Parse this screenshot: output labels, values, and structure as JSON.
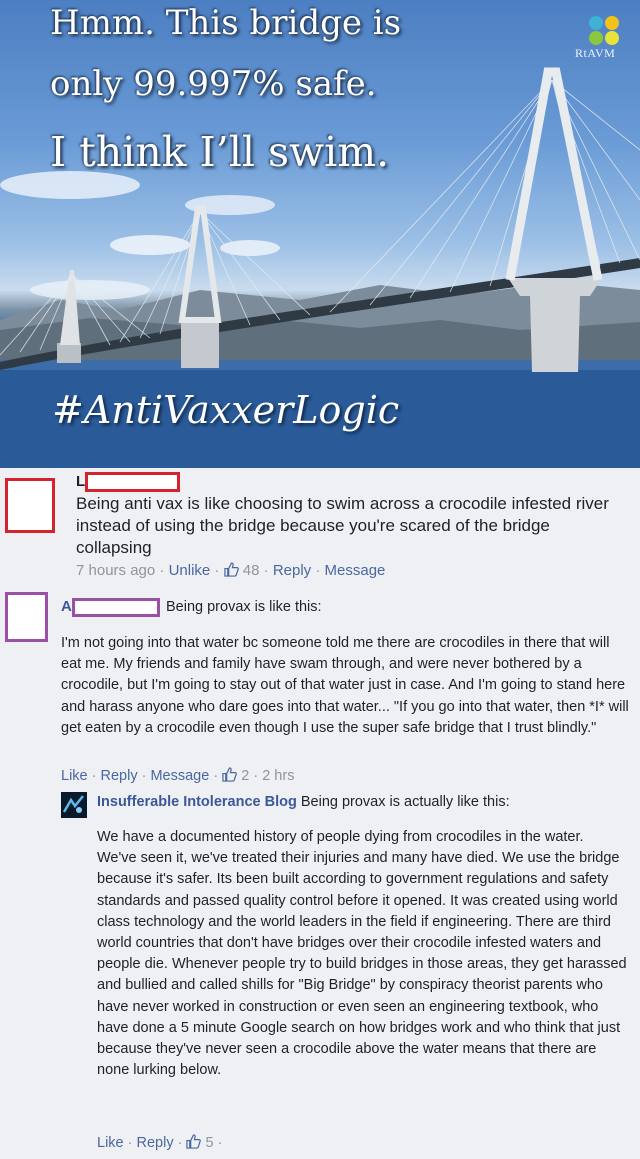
{
  "meme": {
    "line1": "Hmm. This bridge is",
    "line2": "only 99.997% safe.",
    "line3": "I think I’ll swim.",
    "hashtag": "#AntiVaxxerLogic",
    "brand": "RtAVM",
    "brand_icon": "four-dot-logo-icon"
  },
  "comments": [
    {
      "initial": "L",
      "text": "Being anti vax is like choosing to swim across a crocodile infested river instead of using the bridge because you're scared of the bridge collapsing",
      "time": "7 hours ago",
      "unlike": "Unlike",
      "likes": "48",
      "reply": "Reply",
      "message": "Message",
      "redact_color": "#d3232d"
    },
    {
      "initial": "A",
      "lead": "Being provax is like this:",
      "text": "I'm not going into that water bc someone told me there are crocodiles in there that will eat me. My friends and family have swam through, and were never bothered by a crocodile, but I'm going to stay out of that water just in case. And I'm going to stand here and harass anyone who dare goes into that water... \"If you go into that water, then *I* will get eaten by a crocodile even though I use the super safe bridge that I trust blindly.\"",
      "like": "Like",
      "reply": "Reply",
      "message": "Message",
      "likes": "2",
      "time": "2 hrs",
      "redact_color": "#9b4fa5"
    },
    {
      "author": "Insufferable Intolerance Blog",
      "lead": "Being provax is actually like this:",
      "text": "We have a documented history of people dying from crocodiles in the water. We've seen it, we've treated their injuries and many have died. We use the bridge because it's safer. Its been built according to government regulations and safety standards and passed quality control before it opened. It was created using world class technology and the world leaders in the field if engineering. There are third world countries that don't have bridges over their crocodile infested waters and people die. Whenever people try to build bridges in those areas, they get harassed and bullied and called shills for \"Big Bridge\" by conspiracy theorist parents who have never worked in construction or even seen an engineering textbook, who have done a 5 minute Google search on how bridges work and who think that just because they've never seen a crocodile above the water means that there are none lurking below.",
      "like": "Like",
      "reply": "Reply",
      "likes": "5"
    }
  ],
  "colors": {
    "link": "#3b5998",
    "meta": "#90949c",
    "background": "#eef0f4"
  }
}
